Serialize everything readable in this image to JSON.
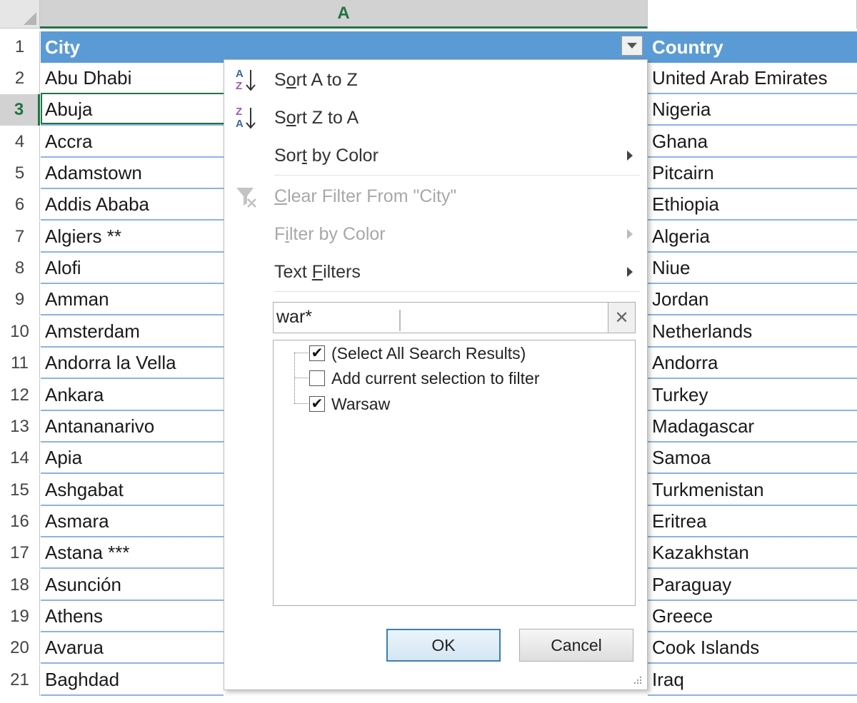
{
  "grid": {
    "column_letter": "A",
    "header_row": {
      "row_number": "1",
      "city": "City",
      "country": "Country"
    },
    "rows": [
      {
        "n": "2",
        "city": "Abu Dhabi",
        "country": "United Arab Emirates"
      },
      {
        "n": "3",
        "city": "Abuja",
        "country": "Nigeria"
      },
      {
        "n": "4",
        "city": "Accra",
        "country": "Ghana"
      },
      {
        "n": "5",
        "city": "Adamstown",
        "country": "Pitcairn"
      },
      {
        "n": "6",
        "city": "Addis Ababa",
        "country": "Ethiopia"
      },
      {
        "n": "7",
        "city": "Algiers **",
        "country": "Algeria"
      },
      {
        "n": "8",
        "city": "Alofi",
        "country": "Niue"
      },
      {
        "n": "9",
        "city": "Amman",
        "country": "Jordan"
      },
      {
        "n": "10",
        "city": "Amsterdam",
        "country": "Netherlands"
      },
      {
        "n": "11",
        "city": "Andorra la Vella",
        "country": "Andorra"
      },
      {
        "n": "12",
        "city": "Ankara",
        "country": "Turkey"
      },
      {
        "n": "13",
        "city": "Antananarivo",
        "country": "Madagascar"
      },
      {
        "n": "14",
        "city": "Apia",
        "country": "Samoa"
      },
      {
        "n": "15",
        "city": "Ashgabat",
        "country": "Turkmenistan"
      },
      {
        "n": "16",
        "city": "Asmara",
        "country": "Eritrea"
      },
      {
        "n": "17",
        "city": "Astana ***",
        "country": "Kazakhstan"
      },
      {
        "n": "18",
        "city": "Asunción",
        "country": "Paraguay"
      },
      {
        "n": "19",
        "city": "Athens",
        "country": "Greece"
      },
      {
        "n": "20",
        "city": "Avarua",
        "country": "Cook Islands"
      },
      {
        "n": "21",
        "city": "Baghdad",
        "country": "Iraq"
      }
    ]
  },
  "filter_menu": {
    "sort_a_z": {
      "pre": "S",
      "key": "o",
      "post": "rt A to Z"
    },
    "sort_z_a": {
      "pre": "S",
      "key": "o",
      "post": "rt Z to A"
    },
    "sort_by_color": {
      "pre": "Sor",
      "key": "t",
      "post": " by Color"
    },
    "clear_filter": {
      "pre": "",
      "key": "C",
      "post": "lear Filter From \"City\""
    },
    "filter_by_color": {
      "pre": "F",
      "key": "i",
      "post": "lter by Color"
    },
    "text_filters": {
      "pre": "Text ",
      "key": "F",
      "post": "ilters"
    },
    "search_value": "war*",
    "search_clear_glyph": "✕",
    "items": [
      {
        "label": "(Select All Search Results)",
        "checked": true
      },
      {
        "label": "Add current selection to filter",
        "checked": false
      },
      {
        "label": "Warsaw",
        "checked": true
      }
    ],
    "ok_label": "OK",
    "cancel_label": "Cancel",
    "check_glyph": "✔"
  },
  "colors": {
    "header_fill": "#5b9bd5",
    "row_border": "#8db3e2",
    "excel_green": "#217346"
  },
  "icons": [
    "sort-ascending-icon",
    "sort-descending-icon",
    "clear-filter-icon",
    "submenu-arrow-icon",
    "dropdown-arrow-icon",
    "resize-grip-icon"
  ]
}
